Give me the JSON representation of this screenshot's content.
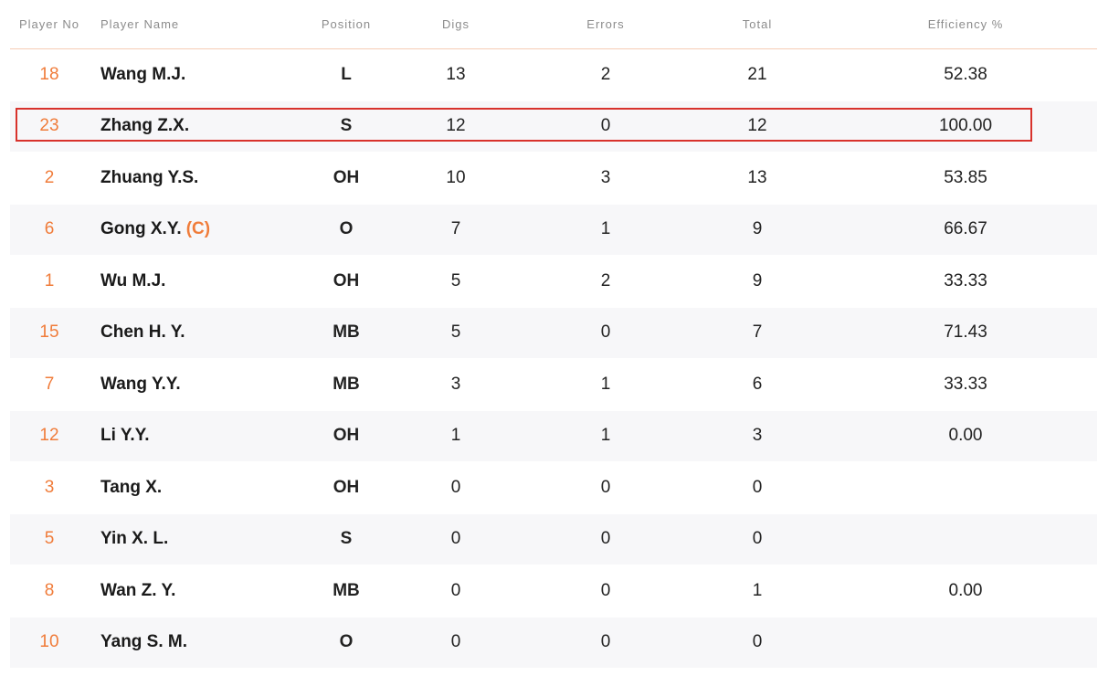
{
  "headers": {
    "no": "Player No",
    "name": "Player Name",
    "position": "Position",
    "digs": "Digs",
    "errors": "Errors",
    "total": "Total",
    "efficiency": "Efficiency %"
  },
  "captain_mark": "(C)",
  "rows": [
    {
      "no": "18",
      "name": "Wang M.J.",
      "position": "L",
      "digs": "13",
      "errors": "2",
      "total": "21",
      "efficiency": "52.38"
    },
    {
      "no": "23",
      "name": "Zhang Z.X.",
      "position": "S",
      "digs": "12",
      "errors": "0",
      "total": "12",
      "efficiency": "100.00",
      "highlighted": true
    },
    {
      "no": "2",
      "name": "Zhuang Y.S.",
      "position": "OH",
      "digs": "10",
      "errors": "3",
      "total": "13",
      "efficiency": "53.85"
    },
    {
      "no": "6",
      "name": "Gong X.Y.",
      "captain": true,
      "position": "O",
      "digs": "7",
      "errors": "1",
      "total": "9",
      "efficiency": "66.67"
    },
    {
      "no": "1",
      "name": "Wu M.J.",
      "position": "OH",
      "digs": "5",
      "errors": "2",
      "total": "9",
      "efficiency": "33.33"
    },
    {
      "no": "15",
      "name": "Chen H. Y.",
      "position": "MB",
      "digs": "5",
      "errors": "0",
      "total": "7",
      "efficiency": "71.43"
    },
    {
      "no": "7",
      "name": "Wang Y.Y.",
      "position": "MB",
      "digs": "3",
      "errors": "1",
      "total": "6",
      "efficiency": "33.33"
    },
    {
      "no": "12",
      "name": "Li Y.Y.",
      "position": "OH",
      "digs": "1",
      "errors": "1",
      "total": "3",
      "efficiency": "0.00"
    },
    {
      "no": "3",
      "name": "Tang X.",
      "position": "OH",
      "digs": "0",
      "errors": "0",
      "total": "0",
      "efficiency": ""
    },
    {
      "no": "5",
      "name": "Yin X. L.",
      "position": "S",
      "digs": "0",
      "errors": "0",
      "total": "0",
      "efficiency": ""
    },
    {
      "no": "8",
      "name": "Wan Z. Y.",
      "position": "MB",
      "digs": "0",
      "errors": "0",
      "total": "1",
      "efficiency": "0.00"
    },
    {
      "no": "10",
      "name": "Yang S. M.",
      "position": "O",
      "digs": "0",
      "errors": "0",
      "total": "0",
      "efficiency": ""
    }
  ],
  "colors": {
    "accent": "#f07c3a",
    "highlight_border": "#d8322c",
    "stripe": "#f7f7f9"
  }
}
